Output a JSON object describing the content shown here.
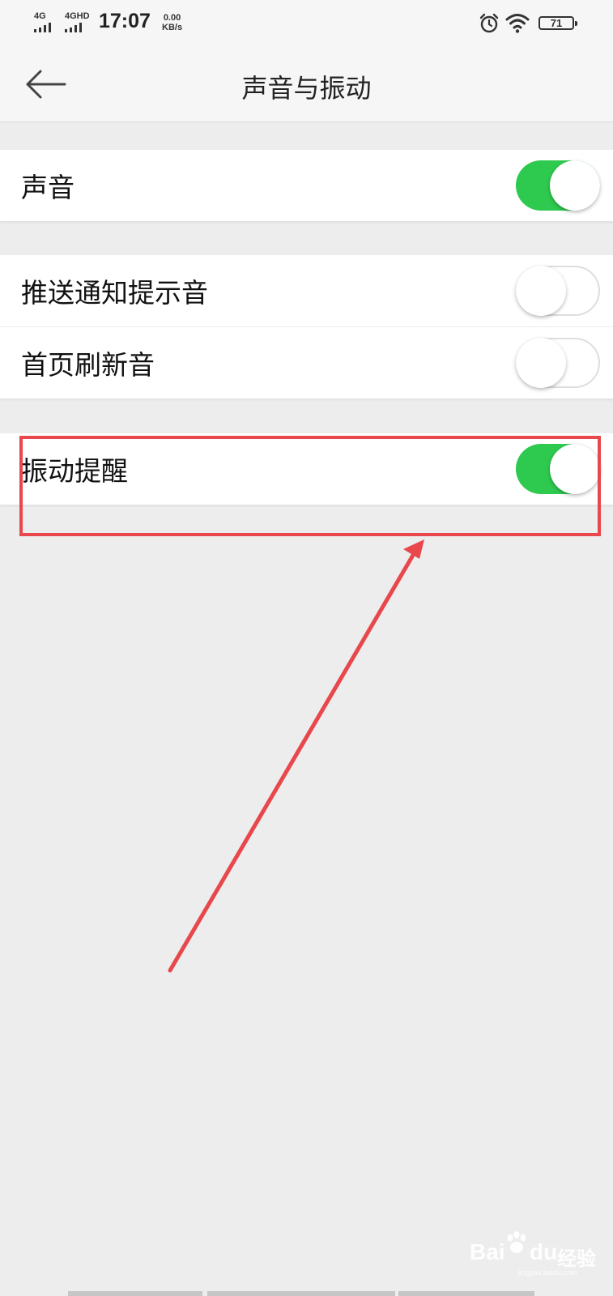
{
  "status_bar": {
    "network_1": "4G",
    "network_2": "4GHD",
    "time": "17:07",
    "speed_value": "0.00",
    "speed_unit": "KB/s",
    "battery_level": "71",
    "icons": [
      "alarm-icon",
      "wifi-icon",
      "battery-icon"
    ]
  },
  "nav": {
    "back_icon": "arrow-left-icon",
    "title": "声音与振动"
  },
  "settings": {
    "sound": {
      "label": "声音",
      "enabled": true
    },
    "push_notification_tone": {
      "label": "推送通知提示音",
      "enabled": false
    },
    "home_refresh_sound": {
      "label": "首页刷新音",
      "enabled": false
    },
    "vibration_alert": {
      "label": "振动提醒",
      "enabled": true
    }
  },
  "annotation": {
    "color": "#e8474b"
  },
  "watermark": {
    "brand_1": "Bai",
    "brand_2": "du",
    "product": "经验",
    "url": "jingyan.baidu.com"
  },
  "colors": {
    "toggle_on": "#2ec94f",
    "background": "#ededed"
  }
}
